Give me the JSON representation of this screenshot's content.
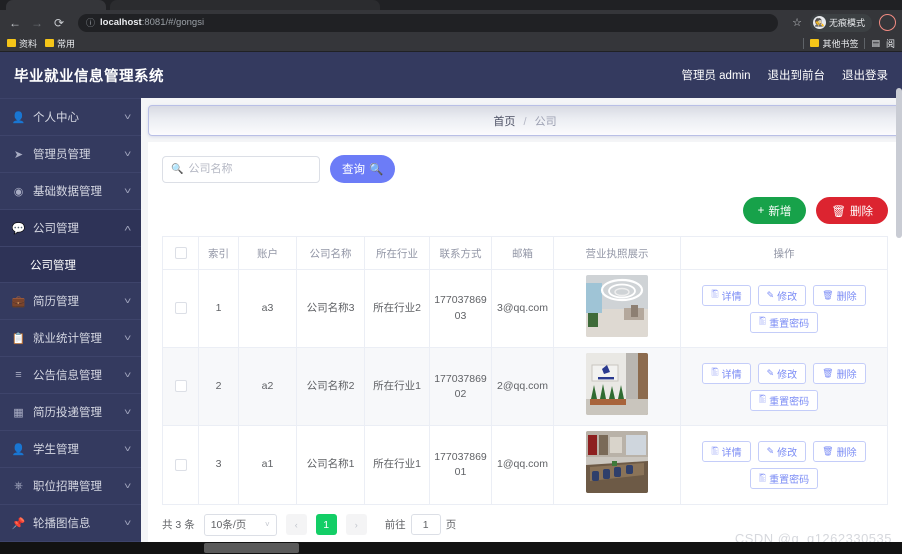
{
  "browser": {
    "url_host": "localhost",
    "url_path": ":8081/#/gongsi",
    "info_icon": "info-circle-icon",
    "back_icon": "←",
    "forward_icon": "→",
    "reload_icon": "⟳",
    "star_icon": "☆",
    "incognito_label": "无痕模式",
    "incognito_icon": "incognito-hat-icon",
    "bookmarks": [
      {
        "label": "资料",
        "icon": "folder-icon"
      },
      {
        "label": "常用",
        "icon": "folder-icon"
      }
    ],
    "other_bookmarks_label": "其他书签",
    "reading_list_label": "阅",
    "reading_list_icon": "list-icon"
  },
  "header": {
    "title": "毕业就业信息管理系统",
    "user_label": "管理员 admin",
    "exit_front_label": "退出到前台",
    "logout_label": "退出登录"
  },
  "sidebar": {
    "items": [
      {
        "label": "个人中心",
        "icon": "user-icon",
        "arrow": "down",
        "active": false
      },
      {
        "label": "管理员管理",
        "icon": "paper-plane-icon",
        "arrow": "down",
        "active": false
      },
      {
        "label": "基础数据管理",
        "icon": "disc-icon",
        "arrow": "down",
        "active": false
      },
      {
        "label": "公司管理",
        "icon": "chat-bubble-icon",
        "arrow": "up",
        "active": true
      },
      {
        "label": "简历管理",
        "icon": "briefcase-icon",
        "arrow": "down",
        "active": false
      },
      {
        "label": "就业统计管理",
        "icon": "clipboard-icon",
        "arrow": "down",
        "active": false
      },
      {
        "label": "公告信息管理",
        "icon": "sliders-icon",
        "arrow": "down",
        "active": false
      },
      {
        "label": "简历投递管理",
        "icon": "grid-icon",
        "arrow": "down",
        "active": false
      },
      {
        "label": "学生管理",
        "icon": "person-icon",
        "arrow": "down",
        "active": false
      },
      {
        "label": "职位招聘管理",
        "icon": "power-icon",
        "arrow": "down",
        "active": false
      },
      {
        "label": "轮播图信息",
        "icon": "pin-icon",
        "arrow": "down",
        "active": false
      }
    ],
    "submenu": {
      "parent_index": 3,
      "label": "公司管理"
    }
  },
  "breadcrumb": {
    "home": "首页",
    "separator": "/",
    "current": "公司"
  },
  "search": {
    "placeholder": "公司名称",
    "value": "",
    "icon": "search-icon",
    "query_label": "查询",
    "query_icon": "search-icon"
  },
  "actions": {
    "add_label": "新增",
    "add_icon": "plus-icon",
    "add_color": "#17a24a",
    "delete_label": "删除",
    "delete_icon": "trash-icon",
    "delete_color": "#dc2430"
  },
  "table": {
    "columns": [
      "索引",
      "账户",
      "公司名称",
      "所在行业",
      "联系方式",
      "邮箱",
      "营业执照展示",
      "操作"
    ],
    "select_all_checked": false,
    "rows": [
      {
        "checked": false,
        "index": "1",
        "account": "a3",
        "company": "公司名称3",
        "industry": "所在行业2",
        "phone": "17703786903",
        "email": "3@qq.com",
        "license_alt": "lobby-interior-photo"
      },
      {
        "checked": false,
        "index": "2",
        "account": "a2",
        "company": "公司名称2",
        "industry": "所在行业1",
        "phone": "17703786902",
        "email": "2@qq.com",
        "license_alt": "office-entrance-photo"
      },
      {
        "checked": false,
        "index": "3",
        "account": "a1",
        "company": "公司名称1",
        "industry": "所在行业1",
        "phone": "17703786901",
        "email": "1@qq.com",
        "license_alt": "meeting-room-photo"
      }
    ],
    "row_ops": [
      {
        "label": "详情",
        "icon": "doc-icon"
      },
      {
        "label": "修改",
        "icon": "pencil-icon"
      },
      {
        "label": "删除",
        "icon": "trash-icon"
      },
      {
        "label": "重置密码",
        "icon": "key-icon"
      }
    ]
  },
  "pagination": {
    "total_prefix": "共",
    "total_count": "3",
    "total_suffix": "条",
    "page_size_label": "10条/页",
    "prev_icon": "‹",
    "next_icon": "›",
    "current_page": "1",
    "jump_prefix": "前往",
    "jump_value": "1",
    "jump_suffix": "页",
    "active_color": "#13ce66"
  },
  "watermark": {
    "text": "CSDN @q_q1262330535"
  }
}
